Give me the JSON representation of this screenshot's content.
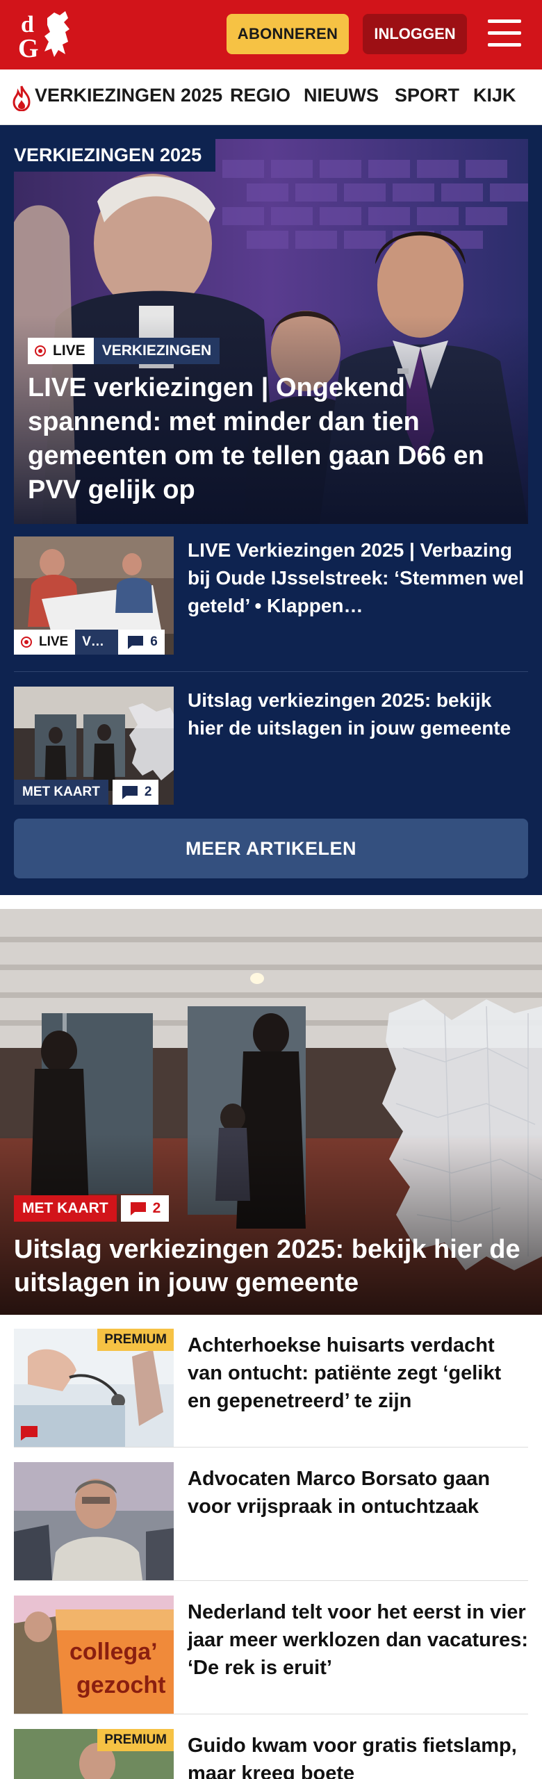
{
  "header": {
    "logo_text": "dG",
    "subscribe_label": "ABONNEREN",
    "login_label": "INLOGGEN",
    "colors": {
      "brand_red": "#d2141a",
      "subscribe_yellow": "#f6c244",
      "login_dark_red": "#9d0f14"
    }
  },
  "nav": {
    "items": [
      {
        "label": "VERKIEZINGEN 2025",
        "icon": "flame-icon"
      },
      {
        "label": "REGIO"
      },
      {
        "label": "NIEUWS"
      },
      {
        "label": "SPORT"
      },
      {
        "label": "KIJK"
      }
    ]
  },
  "election": {
    "section_label": "VERKIEZINGEN 2025",
    "hero": {
      "live_label": "LIVE",
      "category": "VERKIEZINGEN",
      "title": "LIVE verkiezingen | Ongekend spannend: met minder dan tien gemeenten om te tellen gaan D66 en PVV gelijk op"
    },
    "articles": [
      {
        "title": "LIVE Verkiezingen 2025 | Verbazing bij Oude IJsselstreek: ‘Stemmen wel geteld’ • Klappen…",
        "live_label": "LIVE",
        "category": "V…",
        "comments": "6"
      },
      {
        "title": "Uitslag verkiezingen 2025: bekijk hier de uitslagen in jouw gemeente",
        "badge": "MET KAART",
        "comments": "2"
      }
    ],
    "more_label": "MEER ARTIKELEN",
    "colors": {
      "navy": "#0e2350",
      "button": "#34507f"
    }
  },
  "feature": {
    "badge": "MET KAART",
    "comments": "2",
    "title": "Uitslag verkiezingen 2025: bekijk hier de uitslagen in jouw gemeente"
  },
  "list": [
    {
      "title": "Achterhoekse huisarts verdacht van ontucht: patiënte zegt ‘gelikt en gepenetreerd’ te zijn",
      "premium": "PREMIUM"
    },
    {
      "title": "Advocaten Marco Borsato gaan voor vrijspraak in ontuchtzaak"
    },
    {
      "title": "Nederland telt voor het eerst in vier jaar meer werklozen dan vacatures: ‘De rek is eruit’",
      "thumb_text": "collega’ gezocht"
    },
    {
      "title": "Guido kwam voor gratis fietslamp, maar kreeg boete",
      "premium": "PREMIUM"
    }
  ]
}
